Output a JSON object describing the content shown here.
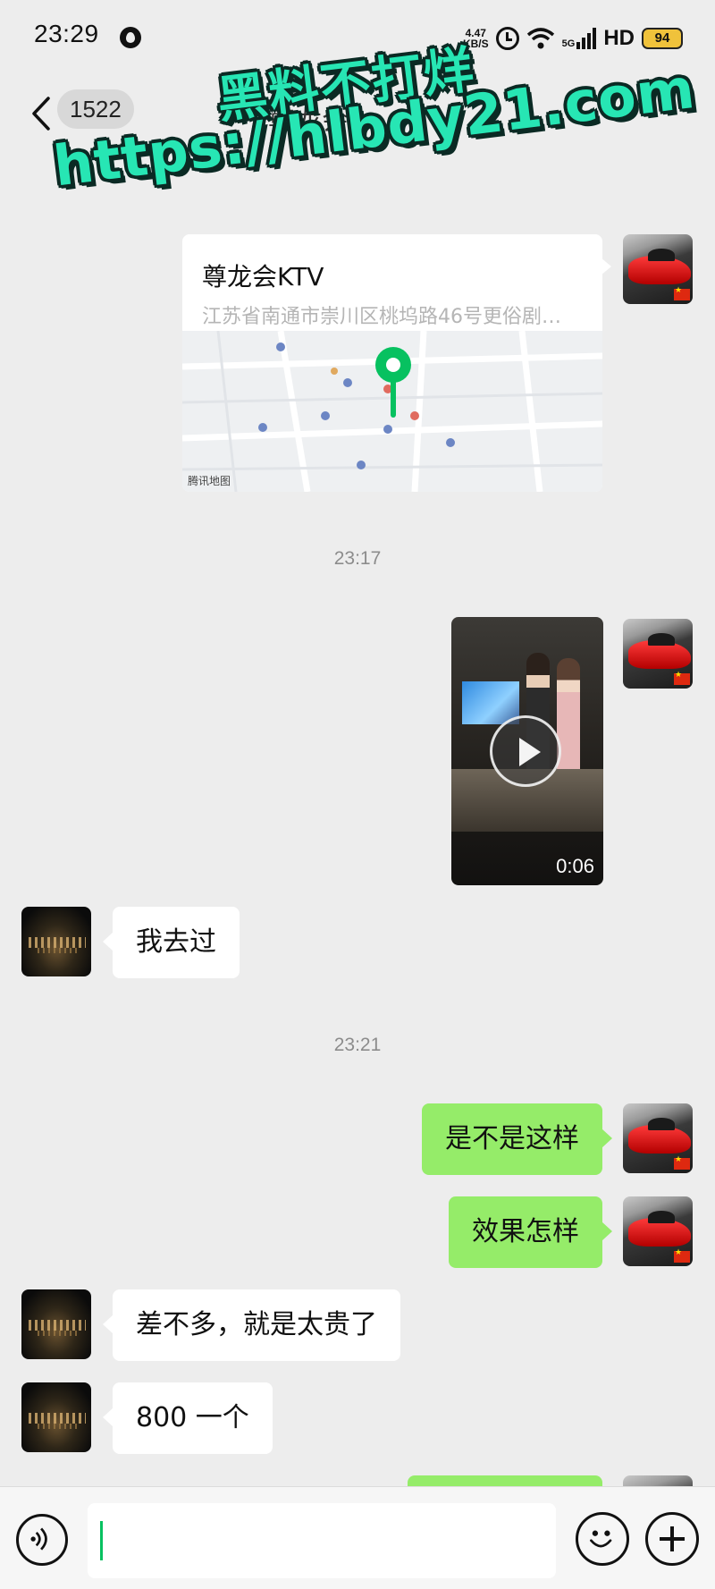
{
  "status_bar": {
    "time": "23:29",
    "net_speed_value": "4.47",
    "net_speed_unit": "KB/S",
    "signal_label": "5G",
    "hd_label": "HD",
    "battery": "94"
  },
  "nav": {
    "unread_count": "1522",
    "title": "尊龙会"
  },
  "watermark": {
    "line1": "黑料不打烊",
    "line2": "https://hlbdy21.com"
  },
  "messages": {
    "location": {
      "name": "尊龙会KTV",
      "address": "江苏省南通市崇川区桃坞路46号更俗剧…",
      "map_label": "腾讯地图"
    },
    "time1": "23:17",
    "video_duration": "0:06",
    "reply1": "我去过",
    "time2": "23:21",
    "out1": "是不是这样",
    "out2": "效果怎样",
    "reply2": "差不多，就是太贵了",
    "reply3": "800 一个"
  },
  "colors": {
    "background": "#ededed",
    "out_bubble": "#95ec69",
    "in_bubble": "#ffffff",
    "map_pin": "#07c160",
    "watermark": "#27e6b4"
  },
  "icons": [
    "back-chevron-icon",
    "alarm-clock-icon",
    "wifi-icon",
    "signal-bars-icon",
    "battery-icon",
    "map-pin-icon",
    "play-icon",
    "voice-icon",
    "emoji-icon",
    "plus-icon"
  ]
}
